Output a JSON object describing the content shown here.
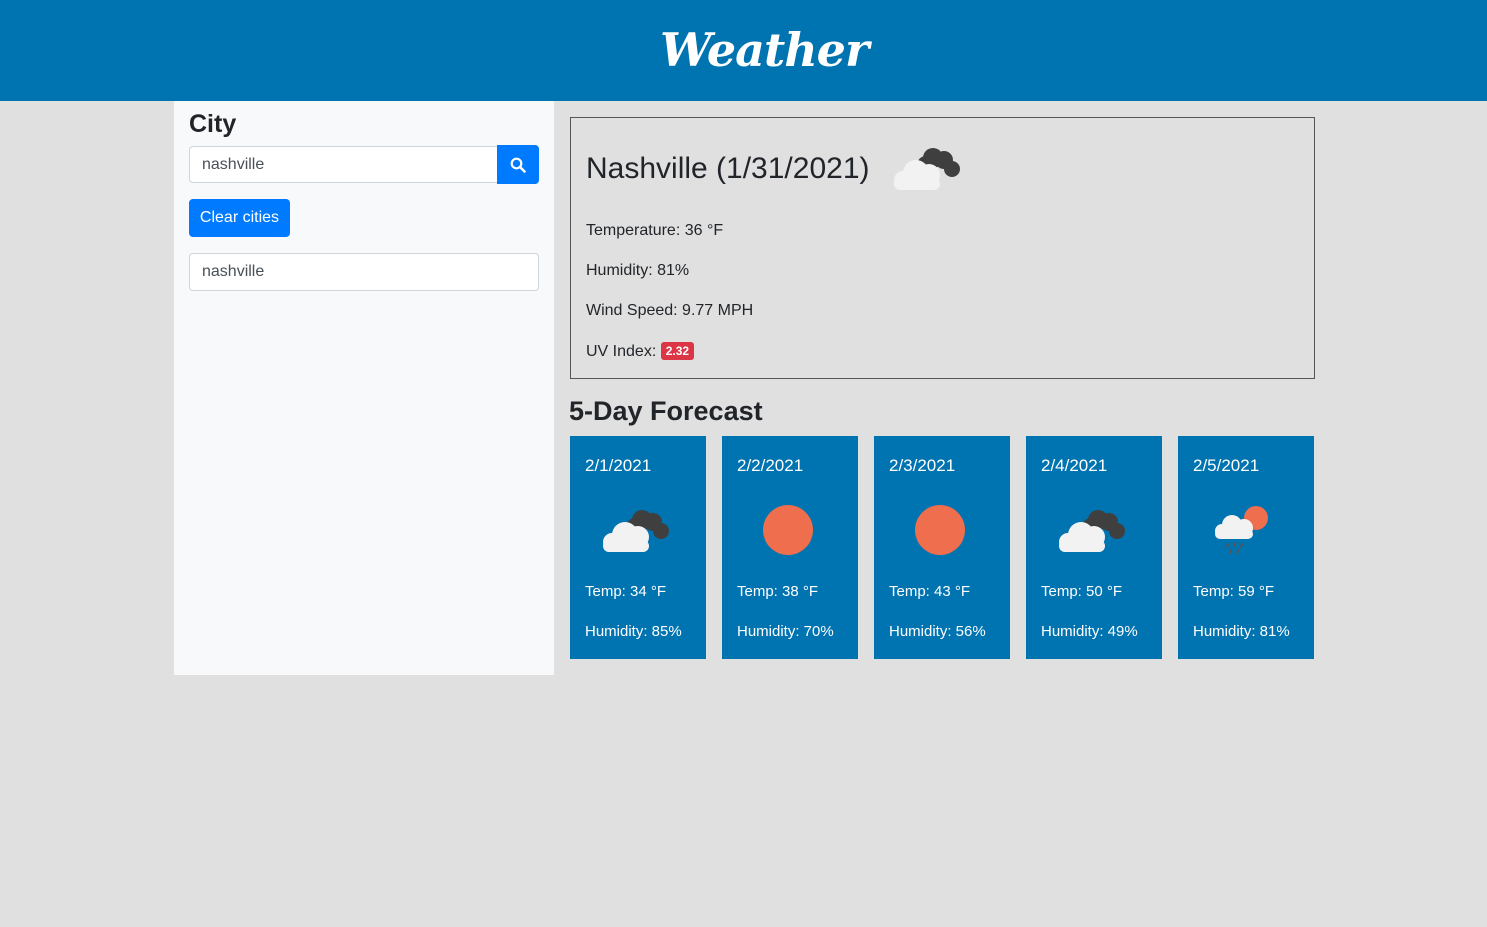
{
  "header": {
    "logo_text": "Weather"
  },
  "sidebar": {
    "title": "City",
    "search_value": "nashville",
    "clear_label": "Clear cities",
    "history": [
      "nashville"
    ]
  },
  "current": {
    "title": "Nashville (1/31/2021)",
    "icon": "broken-clouds-icon",
    "temperature": "Temperature: 36 °F",
    "humidity": "Humidity: 81%",
    "wind": "Wind Speed: 9.77 MPH",
    "uv_label": "UV Index:",
    "uv_value": "2.32",
    "uv_color": "#dc3545"
  },
  "forecast": {
    "title": "5-Day Forecast",
    "days": [
      {
        "date": "2/1/2021",
        "icon": "broken-clouds-icon",
        "temp": "Temp: 34 °F",
        "humidity": "Humidity: 85%"
      },
      {
        "date": "2/2/2021",
        "icon": "clear-sky-icon",
        "temp": "Temp: 38 °F",
        "humidity": "Humidity: 70%"
      },
      {
        "date": "2/3/2021",
        "icon": "clear-sky-icon",
        "temp": "Temp: 43 °F",
        "humidity": "Humidity: 56%"
      },
      {
        "date": "2/4/2021",
        "icon": "broken-clouds-icon",
        "temp": "Temp: 50 °F",
        "humidity": "Humidity: 49%"
      },
      {
        "date": "2/5/2021",
        "icon": "rain-icon",
        "temp": "Temp: 59 °F",
        "humidity": "Humidity: 81%"
      }
    ]
  },
  "colors": {
    "header": "#0073b1",
    "card": "#0073b1",
    "primary": "#007bff",
    "sun": "#ee6e4d"
  }
}
